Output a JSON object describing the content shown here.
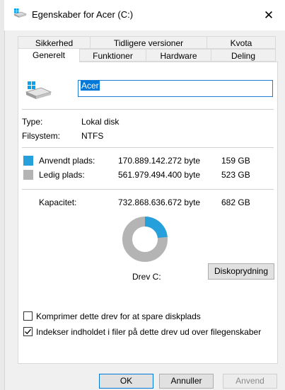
{
  "window": {
    "title": "Egenskaber for Acer (C:)"
  },
  "tabs": {
    "row1": [
      "Sikkerhed",
      "Tidligere versioner",
      "Kvota"
    ],
    "row2": [
      "Generelt",
      "Funktioner",
      "Hardware",
      "Deling"
    ],
    "active": "Generelt"
  },
  "general": {
    "drive_name": "Acer",
    "type_label": "Type:",
    "type_value": "Lokal disk",
    "fs_label": "Filsystem:",
    "fs_value": "NTFS",
    "used_label": "Anvendt plads:",
    "used_bytes": "170.889.142.272 byte",
    "used_gb": "159 GB",
    "free_label": "Ledig plads:",
    "free_bytes": "561.979.494.400 byte",
    "free_gb": "523 GB",
    "capacity_label": "Kapacitet:",
    "capacity_bytes": "732.868.636.672 byte",
    "capacity_gb": "682 GB",
    "used_fraction": 0.2332,
    "drive_label": "Drev C:",
    "cleanup_button": "Diskoprydning",
    "compress_label": "Komprimer dette drev for at spare diskplads",
    "compress_checked": false,
    "index_label": "Indekser indholdet i filer på dette drev ud over filegenskaber",
    "index_checked": true
  },
  "footer": {
    "ok": "OK",
    "cancel": "Annuller",
    "apply": "Anvend"
  },
  "colors": {
    "used": "#26a0da",
    "free": "#b4b4b4",
    "accent": "#0078d7"
  }
}
